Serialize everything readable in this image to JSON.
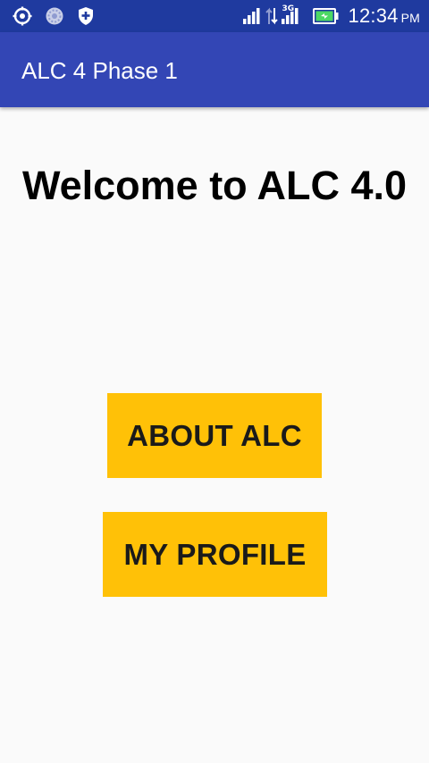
{
  "status_bar": {
    "time": "12:34",
    "ampm": "PM",
    "network_type": "3G",
    "icons": [
      "android-debug-icon",
      "sync-icon",
      "shield-plus-icon",
      "signal-icon",
      "data-arrows-icon",
      "signal-3g-icon",
      "battery-charging-icon"
    ],
    "background": "#1f3a9f"
  },
  "app_bar": {
    "title": "ALC 4 Phase 1",
    "background": "#3346b5"
  },
  "main": {
    "heading": "Welcome to ALC 4.0",
    "about_button_label": "ABOUT ALC",
    "profile_button_label": "MY PROFILE",
    "button_color": "#ffc107"
  }
}
